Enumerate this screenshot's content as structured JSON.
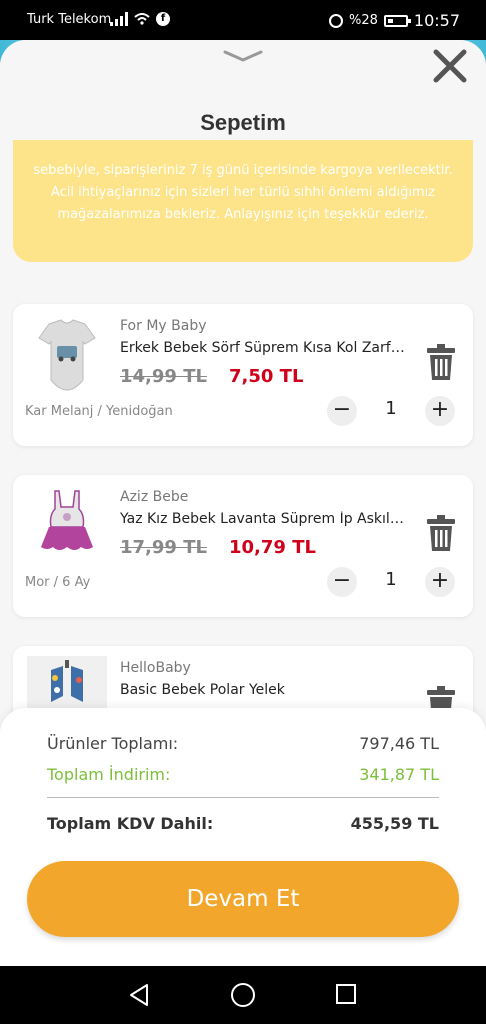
{
  "status_bar": {
    "carrier": "Turk Telekom",
    "battery": "%28",
    "time": "10:57"
  },
  "sheet": {
    "title": "Sepetim"
  },
  "notice": {
    "text": "sebebiyle, siparişleriniz 7 iş günü içerisinde kargoya verilecektir. Acil ihtiyaçlarınız için sizleri her türlü sıhhi önlemi aldığımız mağazalarımıza bekleriz. Anlayışınız için teşekkür ederiz."
  },
  "items": [
    {
      "brand": "For My Baby",
      "name": "Erkek Bebek Sörf Süprem Kısa Kol Zarf Body",
      "old_price": "14,99 TL",
      "new_price": "7,50 TL",
      "variant": "Kar Melanj / Yenidoğan",
      "qty": "1"
    },
    {
      "brand": "Aziz Bebe",
      "name": "Yaz Kız Bebek Lavanta Süprem İp Askılı Body",
      "old_price": "17,99 TL",
      "new_price": "10,79 TL",
      "variant": "Mor / 6 Ay",
      "qty": "1"
    },
    {
      "brand": "HelloBaby",
      "name": "Basic Bebek Polar Yelek"
    }
  ],
  "summary": {
    "subtotal_label": "Ürünler Toplamı:",
    "subtotal_value": "797,46 TL",
    "discount_label": "Toplam İndirim:",
    "discount_value": "341,87 TL",
    "total_label": "Toplam KDV Dahil:",
    "total_value": "455,59 TL",
    "cta_label": "Devam Et"
  },
  "colors": {
    "accent": "#f2a72c",
    "price_red": "#d0021b",
    "discount_green": "#7cbf3a",
    "notice_yellow": "#fde48a"
  }
}
